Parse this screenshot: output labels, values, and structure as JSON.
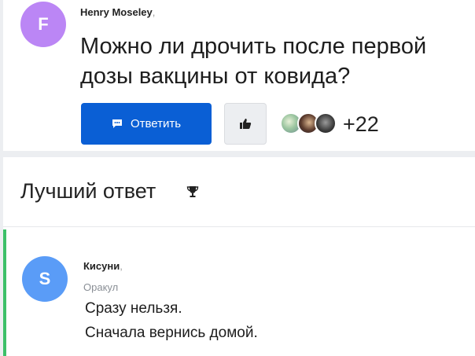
{
  "question": {
    "avatar_letter": "F",
    "author": "Henry Moseley",
    "comma": ",",
    "text": "Можно ли дрочить после первой дозы вакцины от ковида?",
    "reply_button_label": "Ответить",
    "likes_count": "+22"
  },
  "best_answer": {
    "heading": "Лучший ответ",
    "avatar_letter": "S",
    "author": "Кисуни",
    "comma": ",",
    "status": "Оракул",
    "lines": [
      "Сразу нельзя.",
      "Сначала вернись домой."
    ]
  },
  "colors": {
    "question_avatar": "#bb86f5",
    "answer_avatar": "#5a9cf7",
    "primary_button": "#0a5fd5",
    "best_accent": "#3cc068"
  },
  "icons": {
    "reply": "chat-bubble-icon",
    "like": "thumbs-up-icon",
    "best": "trophy-icon"
  }
}
